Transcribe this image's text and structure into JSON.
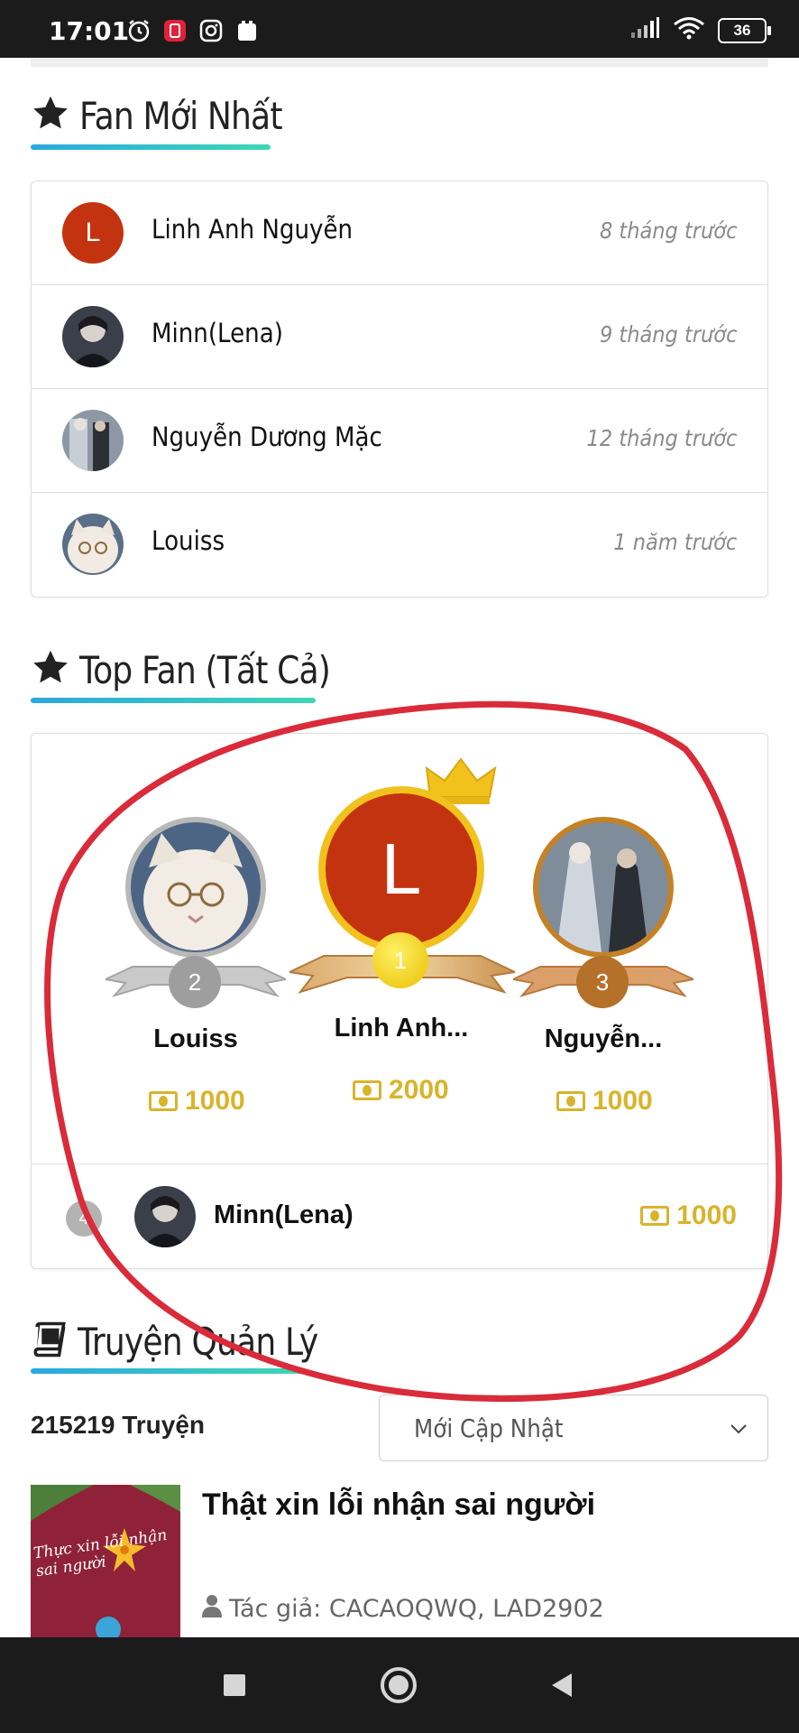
{
  "status_bar": {
    "time": "17:01",
    "battery": "36",
    "icons_left": [
      "alarm-icon",
      "app-notification-icon",
      "instagram-icon",
      "clipboard-icon"
    ],
    "icons_right": [
      "signal-icon",
      "wifi-icon",
      "battery-icon"
    ]
  },
  "latest_fans": {
    "title": "Fan Mới Nhất",
    "items": [
      {
        "name": "Linh Anh Nguyễn",
        "time": "8 tháng trước",
        "avatar_letter": "L"
      },
      {
        "name": "Minn(Lena)",
        "time": "9 tháng trước"
      },
      {
        "name": "Nguyễn Dương Mặc",
        "time": "12 tháng trước"
      },
      {
        "name": "Louiss",
        "time": "1 năm trước"
      }
    ]
  },
  "top_fans": {
    "title": "Top Fan (Tất Cả)",
    "podium": [
      {
        "rank": "2",
        "name": "Louiss",
        "amount": "1000"
      },
      {
        "rank": "1",
        "name": "Linh Anh...",
        "amount": "2000",
        "avatar_letter": "L"
      },
      {
        "rank": "3",
        "name": "Nguyễn...",
        "amount": "1000"
      }
    ],
    "others": [
      {
        "rank": "4",
        "name": "Minn(Lena)",
        "amount": "1000"
      }
    ]
  },
  "managed_stories": {
    "title": "Truyện Quản Lý",
    "count": "215219 Truyện",
    "sort_selected": "Mới Cập Nhật",
    "story": {
      "title": "Thật xin lỗi nhận sai người",
      "author": "Tác giả: CACAOQWQ, LAD2902",
      "cover_text": "Thực xin lỗi nhận sai người"
    }
  },
  "colors": {
    "accent_gradient_start": "#2aa8e0",
    "accent_gradient_end": "#3ed7b5",
    "coin": "#d9b32c",
    "annotation": "#d92b3a"
  }
}
